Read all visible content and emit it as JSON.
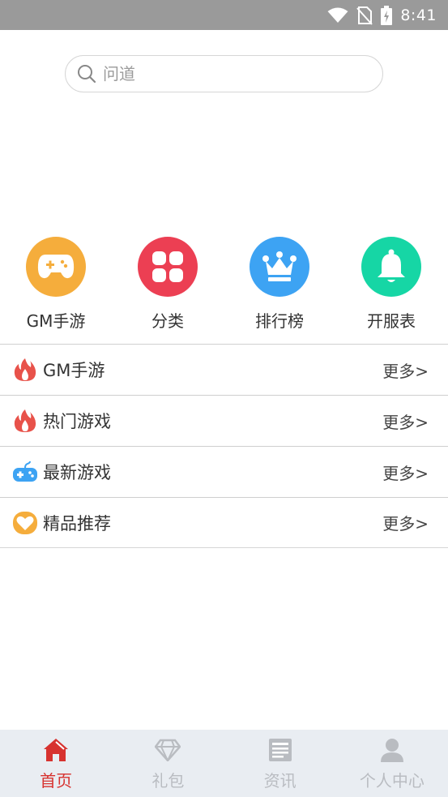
{
  "status_bar": {
    "time": "8:41"
  },
  "search": {
    "placeholder": "问道"
  },
  "quick_nav": [
    {
      "label": "GM手游",
      "icon": "gamepad-icon",
      "color": "#F5AD3C"
    },
    {
      "label": "分类",
      "icon": "grid-icon",
      "color": "#EC3F53"
    },
    {
      "label": "排行榜",
      "icon": "crown-icon",
      "color": "#3DA3F3"
    },
    {
      "label": "开服表",
      "icon": "bell-icon",
      "color": "#16D6A5"
    }
  ],
  "sections": [
    {
      "title": "GM手游",
      "more": "更多>",
      "icon": "fire-icon"
    },
    {
      "title": "热门游戏",
      "more": "更多>",
      "icon": "fire-icon"
    },
    {
      "title": "最新游戏",
      "more": "更多>",
      "icon": "gamepad-icon"
    },
    {
      "title": "精品推荐",
      "more": "更多>",
      "icon": "heart-icon"
    }
  ],
  "tabs": [
    {
      "label": "首页",
      "icon": "home-icon",
      "active": true
    },
    {
      "label": "礼包",
      "icon": "diamond-icon",
      "active": false
    },
    {
      "label": "资讯",
      "icon": "news-icon",
      "active": false
    },
    {
      "label": "个人中心",
      "icon": "user-icon",
      "active": false
    }
  ],
  "colors": {
    "accent": "#D7322F",
    "tab_inactive": "#B9BCC1",
    "fire": "#E8524A",
    "new_game": "#3DA3F3",
    "featured": "#F5AD3C"
  }
}
